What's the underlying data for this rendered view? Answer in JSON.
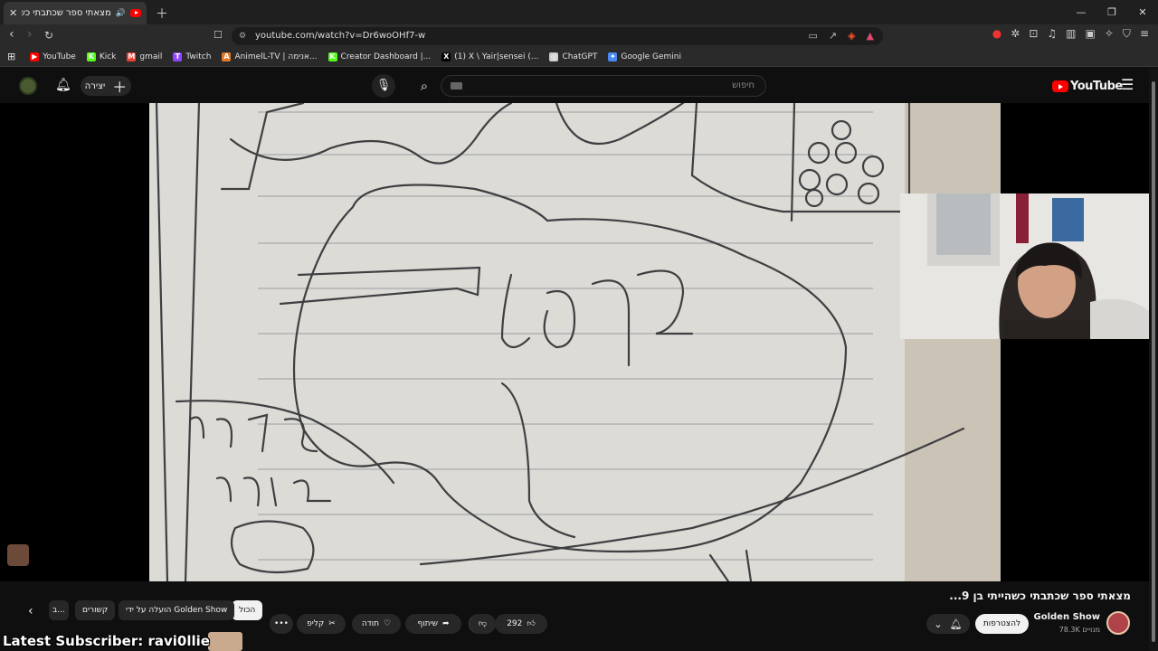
{
  "browser": {
    "tab_title": "מצאתי ספר שכתבתי כשהייתי",
    "url": "youtube.com/watch?v=Dr6woOHf7-w",
    "bookmarks": [
      {
        "label": "YouTube",
        "color": "#ff0000",
        "glyph": "▶"
      },
      {
        "label": "Kick",
        "color": "#53fc18",
        "glyph": "K"
      },
      {
        "label": "gmail",
        "color": "#ea4335",
        "glyph": "M"
      },
      {
        "label": "Twitch",
        "color": "#9146ff",
        "glyph": "T"
      },
      {
        "label": "AnimelL-TV | אנימה...",
        "color": "#e07a2a",
        "glyph": "A"
      },
      {
        "label": "Creator Dashboard |...",
        "color": "#53fc18",
        "glyph": "K"
      },
      {
        "label": "(1) X \\ Yair|sensei (...",
        "color": "#000000",
        "glyph": "X"
      },
      {
        "label": "ChatGPT",
        "color": "#cccccc",
        "glyph": "◎"
      },
      {
        "label": "Google Gemini",
        "color": "#4a8af4",
        "glyph": "✦"
      }
    ]
  },
  "masthead": {
    "create_label": "יצירה",
    "search_placeholder": "חיפוש",
    "logo_text": "YouTube"
  },
  "video": {
    "title": "מצאתי ספר שכתבתי כשהייתי בן 9...",
    "channel_name": "Golden Show",
    "subscribers": "78.3K מנויים",
    "join_label": "להצטרפות",
    "like_count": "292",
    "share_label": "שיתוף",
    "thanks_label": "תודה",
    "clip_label": "קליפ"
  },
  "chips": [
    {
      "label": "הכול",
      "active": true
    },
    {
      "label": "הועלה על ידי Golden Show",
      "active": false
    },
    {
      "label": "קשורים",
      "active": false
    },
    {
      "label": "ב...",
      "active": false
    }
  ],
  "stream_overlay": {
    "latest_subscriber": "Latest Subscriber: ravi0llie"
  },
  "icons": {
    "bell": "bell-icon",
    "mic": "mic-icon",
    "search": "search-icon",
    "like": "thumbs-up-icon",
    "dislike": "thumbs-down-icon"
  }
}
